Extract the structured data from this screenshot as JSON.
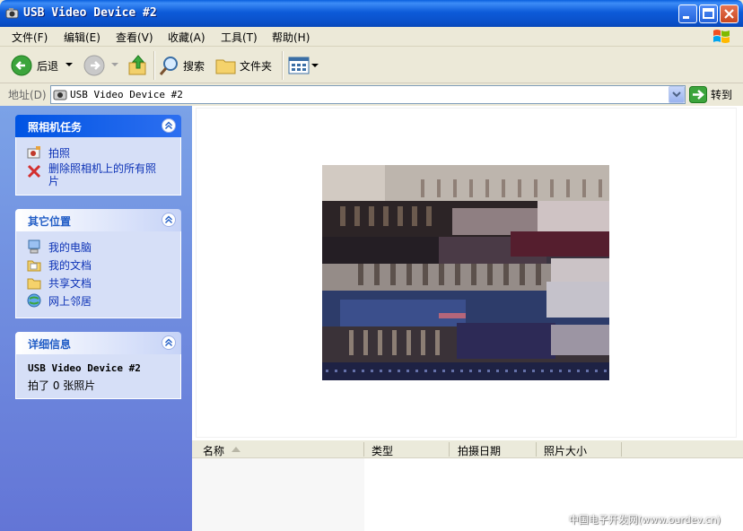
{
  "window": {
    "title": "USB Video Device #2"
  },
  "menu": {
    "items": [
      {
        "label": "文件(F)"
      },
      {
        "label": "编辑(E)"
      },
      {
        "label": "查看(V)"
      },
      {
        "label": "收藏(A)"
      },
      {
        "label": "工具(T)"
      },
      {
        "label": "帮助(H)"
      }
    ]
  },
  "toolbar": {
    "back_label": "后退",
    "search_label": "搜索",
    "folders_label": "文件夹"
  },
  "address": {
    "label": "地址(D)",
    "value": "USB Video Device #2",
    "go_label": "转到"
  },
  "tasks": {
    "camera": {
      "title": "照相机任务",
      "items": [
        {
          "label": "拍照",
          "icon": "camera-icon"
        },
        {
          "label": "删除照相机上的所有照片",
          "icon": "delete-icon"
        }
      ]
    },
    "other_places": {
      "title": "其它位置",
      "items": [
        {
          "label": "我的电脑",
          "icon": "computer-icon"
        },
        {
          "label": "我的文档",
          "icon": "documents-icon"
        },
        {
          "label": "共享文档",
          "icon": "shared-folder-icon"
        },
        {
          "label": "网上邻居",
          "icon": "network-icon"
        }
      ]
    },
    "details": {
      "title": "详细信息",
      "device_name": "USB Video Device #2",
      "photo_count": "拍了 0 张照片"
    }
  },
  "list": {
    "columns": [
      {
        "label": "名称"
      },
      {
        "label": "类型"
      },
      {
        "label": "拍摄日期"
      },
      {
        "label": "照片大小"
      }
    ]
  },
  "watermark": "中国电子开发网(www.ourdev.cn)",
  "colors": {
    "titlebar": "#0A4FC8",
    "taskpane": "#7BA2E7",
    "panel_body": "#D6DFF7",
    "link": "#0C32B6"
  }
}
